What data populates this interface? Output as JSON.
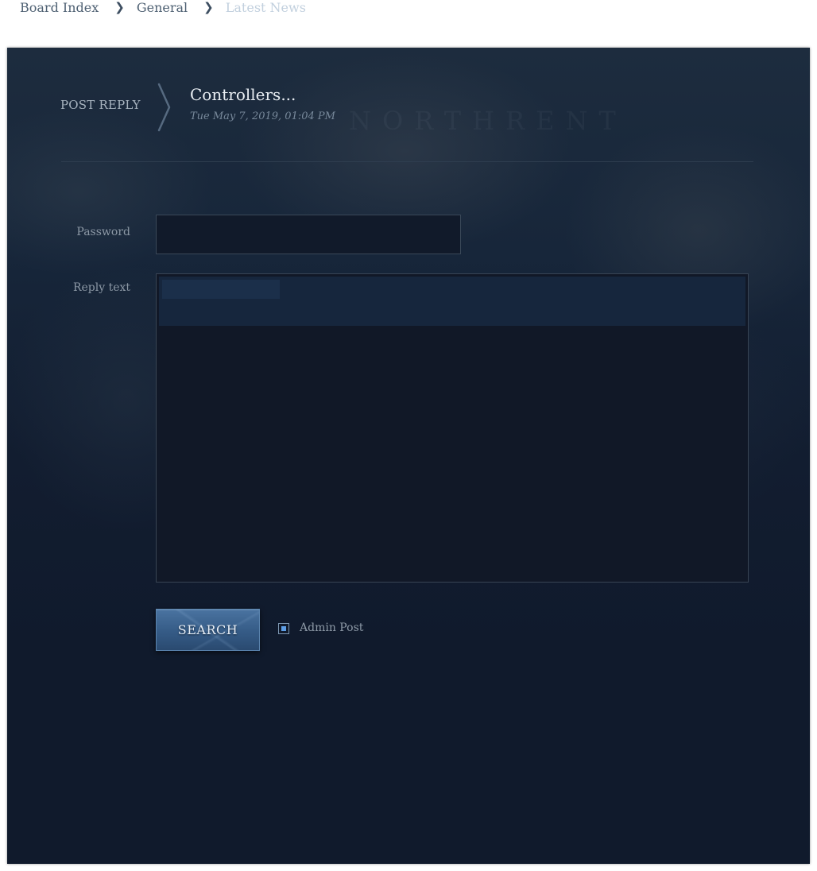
{
  "breadcrumb": {
    "items": [
      {
        "label": "Board Index"
      },
      {
        "label": "General"
      },
      {
        "label": "Latest News"
      }
    ],
    "separator": "❯"
  },
  "header": {
    "section_label": "POST REPLY",
    "title": "Controllers...",
    "date": "Tue May 7, 2019, 01:04 PM"
  },
  "form": {
    "password_label": "Password",
    "password_value": "",
    "reply_label": "Reply text",
    "reply_value": "",
    "submit_label": "SEARCH",
    "admin_post_label": "Admin Post",
    "admin_post_checked": true
  },
  "colors": {
    "panel_background": "#101a2c",
    "button_accent": "#355b86",
    "checkbox_accent": "#5d9ee6"
  },
  "icons": {
    "breadcrumb_separator": "chevron-right-icon",
    "title_separator": "chevron-right-icon"
  }
}
